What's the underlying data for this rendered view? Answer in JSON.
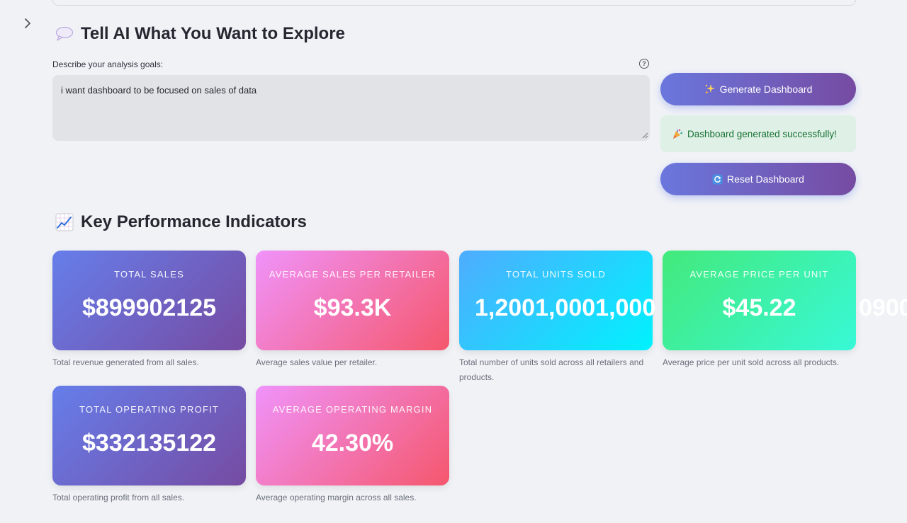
{
  "sidebar": {
    "toggle_icon": "chevron-right-icon"
  },
  "explore": {
    "title": "Tell AI What You Want to Explore",
    "icon": "speech-bubble-icon",
    "label": "Describe your analysis goals:",
    "help_icon": "question-circle-icon",
    "textarea_value": "i want dashboard to be focused on sales of data"
  },
  "actions": {
    "generate_label": "Generate Dashboard",
    "generate_icon": "sparkles-icon",
    "success_message": "Dashboard generated successfully!",
    "success_icon": "party-popper-icon",
    "reset_label": "Reset Dashboard",
    "reset_icon": "refresh-icon",
    "accent_start": "#667eea",
    "accent_end": "#764ba2",
    "success_bg": "#dff0e6",
    "success_text": "#177233"
  },
  "kpi_section": {
    "title": "Key Performance Indicators",
    "icon": "chart-increasing-icon"
  },
  "kpis": [
    {
      "label": "TOTAL SALES",
      "value": "$899902125",
      "description": "Total revenue generated from all sales."
    },
    {
      "label": "AVERAGE SALES PER RETAILER",
      "value": "$93.3K",
      "description": "Average sales value per retailer."
    },
    {
      "label": "TOTAL UNITS SOLD",
      "value": "1,2001,0001,000",
      "overflow_value": "0900",
      "description": "Total number of units sold across all retailers and products."
    },
    {
      "label": "AVERAGE PRICE PER UNIT",
      "value": "$45.22",
      "description": "Average price per unit sold across all products."
    },
    {
      "label": "TOTAL OPERATING PROFIT",
      "value": "$332135122",
      "description": "Total operating profit from all sales."
    },
    {
      "label": "AVERAGE OPERATING MARGIN",
      "value": "42.30%",
      "description": "Average operating margin across all sales."
    }
  ]
}
